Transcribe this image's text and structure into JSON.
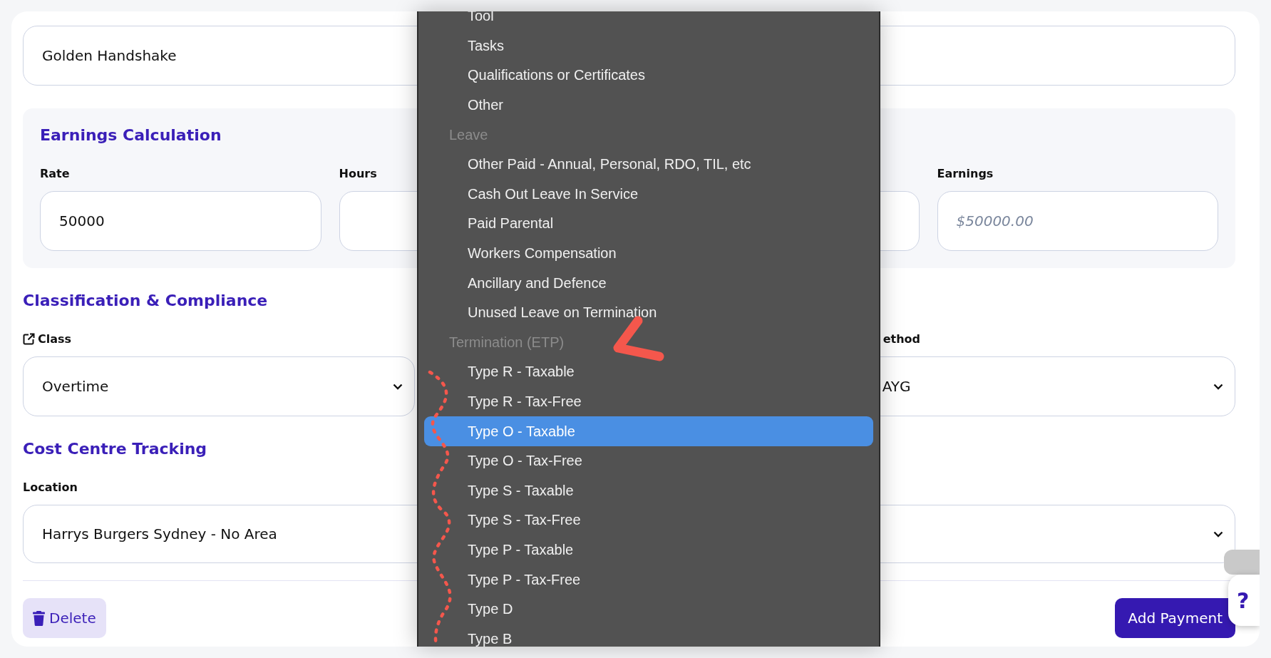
{
  "title_field": {
    "value": "Golden Handshake"
  },
  "earnings": {
    "heading": "Earnings Calculation",
    "fields": [
      {
        "kind": "input",
        "label": "Rate",
        "value": "50000"
      },
      {
        "kind": "input",
        "label": "Hours"
      },
      {
        "kind": "input"
      },
      {
        "kind": "input",
        "label": "Earnings",
        "placeholder": "$50000.00"
      }
    ]
  },
  "classification": {
    "heading": "Classification & Compliance",
    "fields": [
      {
        "kind": "select",
        "label": "Class",
        "link": true,
        "value": "Overtime"
      },
      {
        "kind": "select",
        "label": "ethod",
        "value": "AYG"
      }
    ]
  },
  "cost_centre": {
    "heading": "Cost Centre Tracking",
    "fields": [
      {
        "kind": "select",
        "label": "Location",
        "value": "Harrys Burgers Sydney - No Area"
      }
    ]
  },
  "footer": {
    "delete_button": "Delete",
    "add_button": "Add Payment"
  },
  "help_button": "?",
  "menu": {
    "items": [
      {
        "kind": "option",
        "label": "Tool",
        "selected": false
      },
      {
        "kind": "option",
        "label": "Tasks",
        "selected": false
      },
      {
        "kind": "option",
        "label": "Qualifications or Certificates",
        "selected": false
      },
      {
        "kind": "option",
        "label": "Other",
        "selected": false
      },
      {
        "kind": "group",
        "label": "Leave"
      },
      {
        "kind": "option",
        "label": "Other Paid - Annual, Personal, RDO, TIL, etc",
        "selected": false
      },
      {
        "kind": "option",
        "label": "Cash Out Leave In Service",
        "selected": false
      },
      {
        "kind": "option",
        "label": "Paid Parental",
        "selected": false
      },
      {
        "kind": "option",
        "label": "Workers Compensation",
        "selected": false
      },
      {
        "kind": "option",
        "label": "Ancillary and Defence",
        "selected": false
      },
      {
        "kind": "option",
        "label": "Unused Leave on Termination",
        "selected": false
      },
      {
        "kind": "group",
        "label": "Termination (ETP)"
      },
      {
        "kind": "option",
        "label": "Type R - Taxable",
        "selected": false
      },
      {
        "kind": "option",
        "label": "Type R - Tax-Free",
        "selected": false
      },
      {
        "kind": "option",
        "label": "Type O - Taxable",
        "selected": true
      },
      {
        "kind": "option",
        "label": "Type O - Tax-Free",
        "selected": false
      },
      {
        "kind": "option",
        "label": "Type S - Taxable",
        "selected": false
      },
      {
        "kind": "option",
        "label": "Type S - Tax-Free",
        "selected": false
      },
      {
        "kind": "option",
        "label": "Type P - Taxable",
        "selected": false
      },
      {
        "kind": "option",
        "label": "Type P - Tax-Free",
        "selected": false
      },
      {
        "kind": "option",
        "label": "Type D",
        "selected": false
      },
      {
        "kind": "option",
        "label": "Type B",
        "selected": false
      }
    ]
  }
}
